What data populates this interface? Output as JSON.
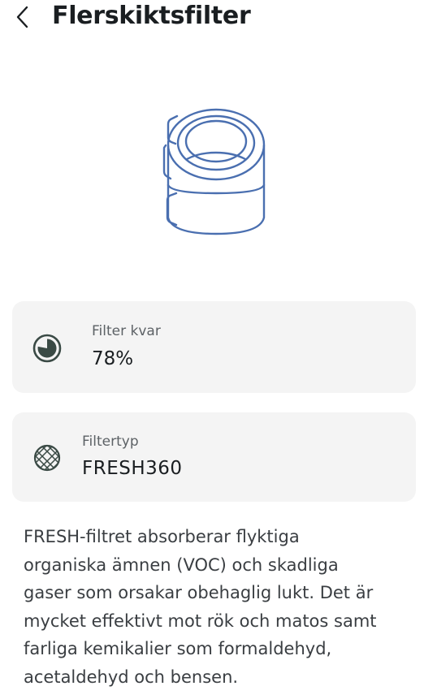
{
  "header": {
    "title": "Flerskiktsfilter",
    "back_icon": "chevron-left-icon"
  },
  "illustration": {
    "icon": "filter-cartridge-icon",
    "stroke_color": "#4a6fb0"
  },
  "filter_remaining": {
    "icon": "progress-pie-icon",
    "label": "Filter kvar",
    "value": "78%",
    "level": 0.78
  },
  "filter_type": {
    "icon": "mesh-filter-icon",
    "label": "Filtertyp",
    "value": "FRESH360"
  },
  "description": {
    "lines": [
      "FRESH-filtret absorberar flyktiga",
      "organiska ämnen (VOC) och skadliga",
      "gaser som orsakar obehaglig lukt. Det är",
      "mycket effektivt mot rök och matos samt",
      "farliga kemikalier som formaldehyd,",
      "acetaldehyd och bensen."
    ]
  },
  "colors": {
    "card_background": "#f4f4f4",
    "icon_dark": "#3a4a45"
  }
}
